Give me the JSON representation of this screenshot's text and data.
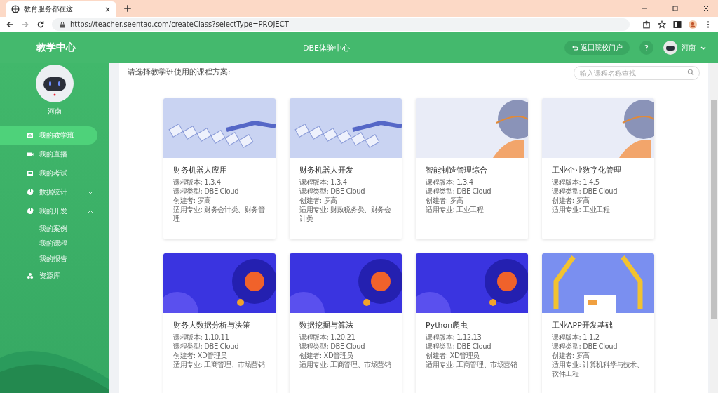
{
  "browser": {
    "tab_title": "教育服务都在这",
    "url": "https://teacher.seentao.com/createClass?selectType=PROJECT"
  },
  "header": {
    "title": "教学中心",
    "center_title": "DBE体验中心",
    "back_button": "返回院校门户",
    "help": "?",
    "user": "河南"
  },
  "sidebar": {
    "user_name": "河南",
    "items": [
      {
        "label": "我的教学班",
        "selected": true
      },
      {
        "label": "我的直播",
        "selected": false
      },
      {
        "label": "我的考试",
        "selected": false
      },
      {
        "label": "数据统计",
        "selected": false,
        "expanded": false
      },
      {
        "label": "我的开发",
        "selected": false,
        "expanded": true,
        "children": [
          {
            "label": "我的案例",
            "selected": false
          },
          {
            "label": "我的课程",
            "selected": false
          },
          {
            "label": "我的报告",
            "selected": false
          }
        ]
      },
      {
        "label": "资源库",
        "selected": false
      }
    ]
  },
  "main": {
    "prompt": "请选择教学班使用的课程方案:",
    "search": {
      "placeholder": "输入课程名称查找"
    },
    "courses": [
      {
        "title": "财务机器人应用",
        "kind": "keyboard",
        "lines": [
          "课程版本: 1.3.4",
          "课程类型: DBE Cloud",
          "创建者: 罗高",
          "适用专业: 财务会计类、财务管理"
        ]
      },
      {
        "title": "财务机器人开发",
        "kind": "keyboard",
        "lines": [
          "课程版本: 1.3.4",
          "课程类型: DBE Cloud",
          "创建者: 罗高",
          "适用专业: 财政税务类、财务会计类"
        ]
      },
      {
        "title": "智能制造管理综合",
        "kind": "globe",
        "lines": [
          "课程版本: 1.3.4",
          "课程类型: DBE Cloud",
          "创建者: 罗高",
          "适用专业: 工业工程"
        ]
      },
      {
        "title": "工业企业数字化管理",
        "kind": "globe",
        "lines": [
          "课程版本: 1.4.5",
          "课程类型: DBE Cloud",
          "创建者: 罗高",
          "适用专业: 工业工程"
        ]
      },
      {
        "title": "财务大数据分析与决策",
        "kind": "space",
        "lines": [
          "课程版本: 1.10.11",
          "课程类型: DBE Cloud",
          "创建者: XD管理员",
          "适用专业: 工商管理、市场营销"
        ]
      },
      {
        "title": "数据挖掘与算法",
        "kind": "space",
        "lines": [
          "课程版本: 1.20.21",
          "课程类型: DBE Cloud",
          "创建者: XD管理员",
          "适用专业: 工商管理、市场营销"
        ]
      },
      {
        "title": "Python爬虫",
        "kind": "space",
        "lines": [
          "课程版本: 1.12.13",
          "课程类型: DBE Cloud",
          "创建者: XD管理员",
          "适用专业: 工商管理、市场营销"
        ]
      },
      {
        "title": "工业APP开发基础",
        "kind": "robot",
        "lines": [
          "课程版本: 1.1.2",
          "课程类型: DBE Cloud",
          "创建者: 罗高",
          "适用专业: 计算机科学与技术、软件工程"
        ]
      }
    ]
  }
}
